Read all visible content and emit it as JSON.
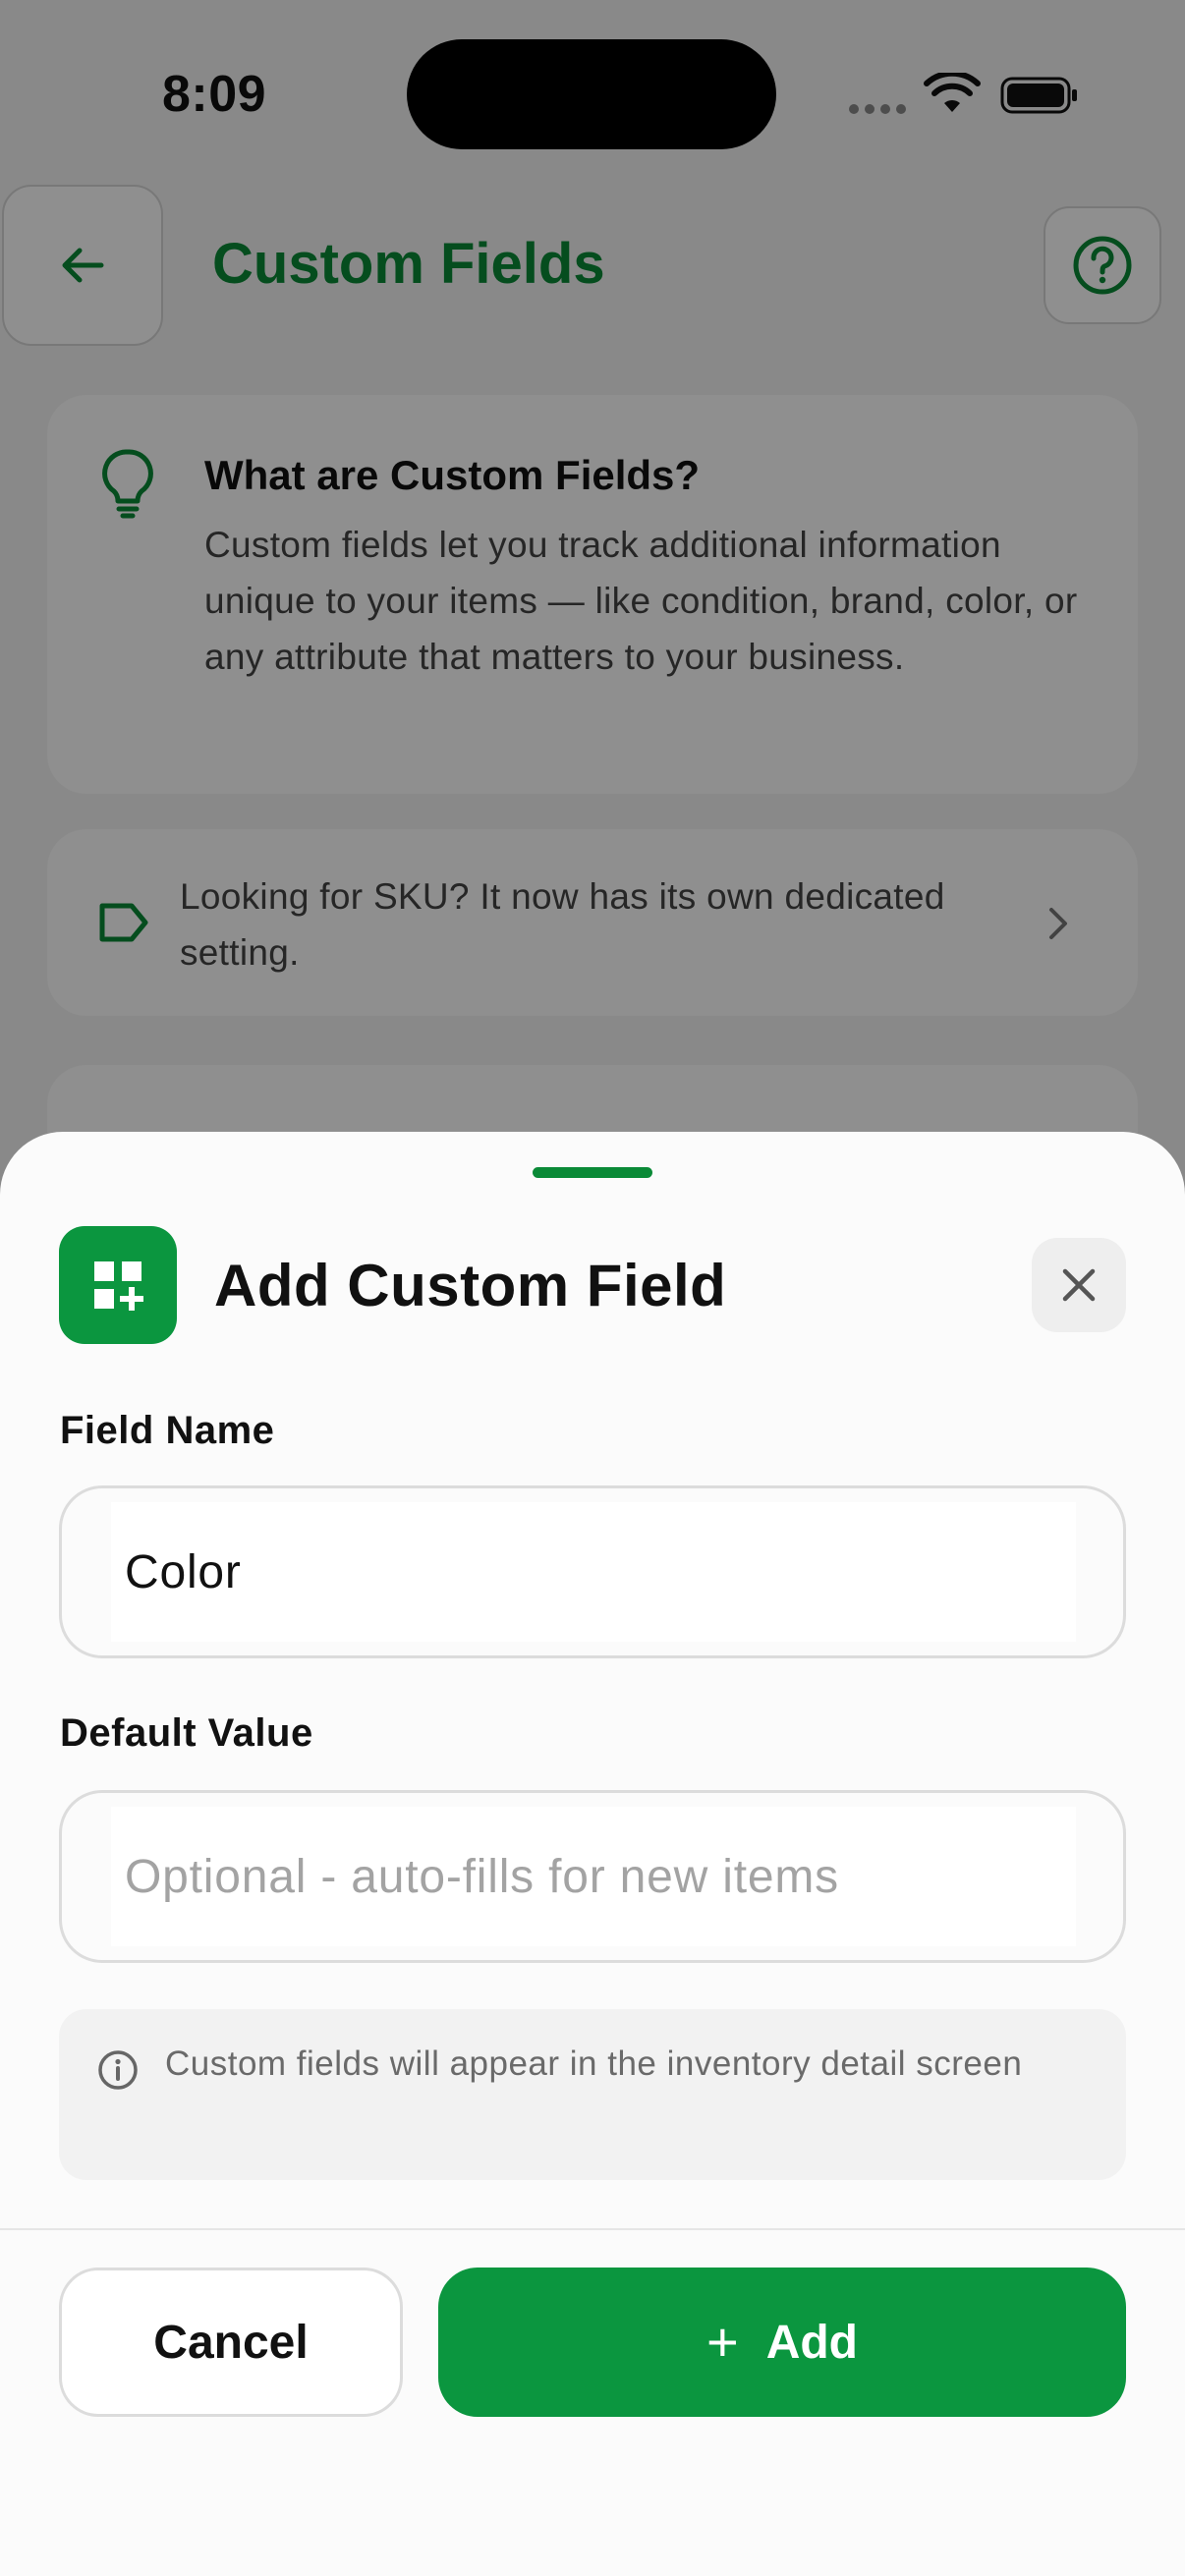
{
  "status_bar": {
    "time": "8:09"
  },
  "header": {
    "title": "Custom Fields"
  },
  "info_card": {
    "title": "What are Custom Fields?",
    "body": "Custom fields let you track additional information unique to your items — like condition, brand, color, or any attribute that matters to your business."
  },
  "sku_card": {
    "text": "Looking for SKU? It now has its own dedicated setting."
  },
  "sheet": {
    "title": "Add Custom Field",
    "field_name": {
      "label": "Field Name",
      "value": "Color"
    },
    "default_value": {
      "label": "Default Value",
      "value": "",
      "placeholder": "Optional - auto-fills for new items"
    },
    "note": "Custom fields will appear in the inventory detail screen",
    "cancel_label": "Cancel",
    "add_label": "Add",
    "add_icon": "+"
  },
  "icons": {
    "back": "arrow-left-icon",
    "help": "question-circle-icon",
    "info_card": "lightbulb-icon",
    "sku": "tag-icon",
    "chevron": "chevron-right-icon",
    "sheet_icon": "grid-add-icon",
    "close": "close-icon",
    "note": "info-circle-icon"
  },
  "colors": {
    "accent": "#0b963f",
    "title_green": "#0a8a37",
    "overlay": "rgba(0,0,0,0.44)"
  }
}
